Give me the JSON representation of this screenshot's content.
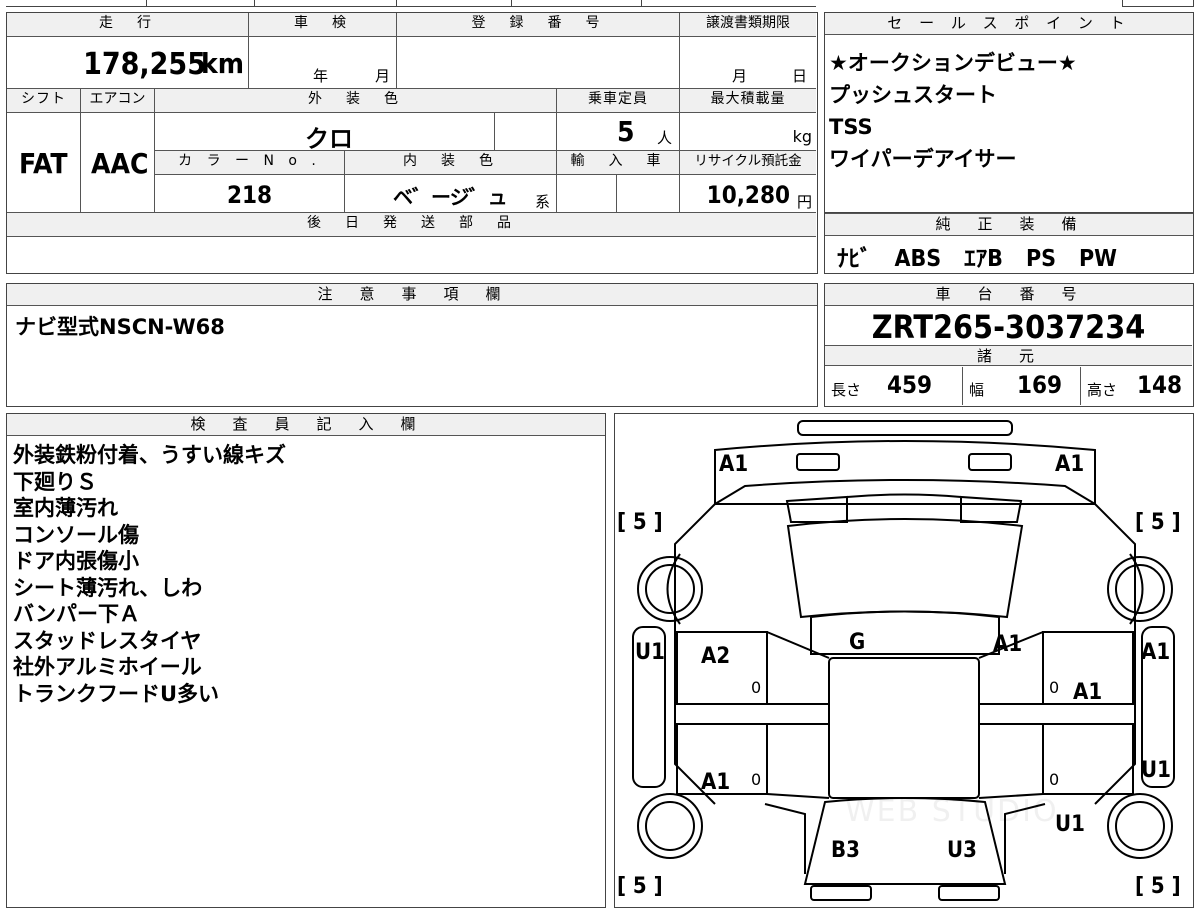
{
  "top_strip": {
    "partial_text": "登",
    "partial_text2": "ど"
  },
  "main_table": {
    "mileage_label": "走　行",
    "mileage_value": "178,255",
    "mileage_unit": "km",
    "inspection_label": "車　検",
    "inspection_year_unit": "年",
    "inspection_month_unit": "月",
    "registration_label": "登　録　番　号",
    "transfer_label": "譲渡書類期限",
    "transfer_month_unit": "月",
    "transfer_day_unit": "日",
    "shift_label": "シフト",
    "ac_label": "エアコン",
    "exterior_color_label": "外　装　色",
    "capacity_label": "乗車定員",
    "max_load_label": "最大積載量",
    "shift_value": "FAT",
    "ac_value": "AAC",
    "exterior_color_value": "クロ",
    "capacity_value": "5",
    "capacity_unit": "人",
    "max_load_unit": "kg",
    "color_no_label": "カ ラ ー N o .",
    "interior_color_label": "内　装　色",
    "import_label": "輸　入　車",
    "recycle_label": "リサイクル預託金",
    "color_no_value": "218",
    "interior_color_value": "ベ゛ージ゛ュ",
    "interior_color_suffix": "系",
    "recycle_value": "10,280",
    "recycle_unit": "円",
    "later_parts_label": "後　日　発　送　部　品"
  },
  "sales_points": {
    "label": "セ ー ル ス ポ イ ン ト",
    "items": [
      "★オークションデビュー★",
      "プッシュスタート",
      "TSS",
      "ワイパーデアイサー"
    ]
  },
  "genuine_equipment": {
    "label": "純　正　装　備",
    "value": "ﾅﾋﾞ　ABS　ｴｱB　PS　PW"
  },
  "notes": {
    "label": "注　意　事　項　欄",
    "value": "ナビ型式NSCN-W68"
  },
  "chassis": {
    "label": "車　台　番　号",
    "value": "ZRT265-3037234",
    "specs_label": "諸　元",
    "length_label": "長さ",
    "length_value": "459",
    "width_label": "幅",
    "width_value": "169",
    "height_label": "高さ",
    "height_value": "148"
  },
  "inspector": {
    "label": "検　査　員　記　入　欄",
    "lines": [
      "外装鉄粉付着、うすい線キズ",
      "下廻りＳ",
      "室内薄汚れ",
      "コンソール傷",
      "ドア内張傷小",
      "シート薄汚れ、しわ",
      "バンパー下Ａ",
      "スタッドレスタイヤ",
      "社外アルミホイール",
      "トランクフードU多い"
    ]
  },
  "diagram": {
    "marks": {
      "front_left": "A1",
      "front_right": "A1",
      "tire_fl": "[ 5 ]",
      "tire_fr": "[ 5 ]",
      "tire_rl": "[ 5 ]",
      "tire_rr": "[ 5 ]",
      "left_fender": "U1",
      "right_fender": "A1",
      "glass": "G",
      "front_door_left": "A2",
      "pillar_right": "A1",
      "front_door_right": "A1",
      "rear_door_left": "A1",
      "rear_quarter_right": "U1",
      "rear_right": "U1",
      "rear_left": "B3",
      "rear_center": "U3",
      "zero1": "0",
      "zero2": "0",
      "zero3": "0",
      "zero4": "0"
    },
    "watermark": "WEB STUDIO"
  }
}
